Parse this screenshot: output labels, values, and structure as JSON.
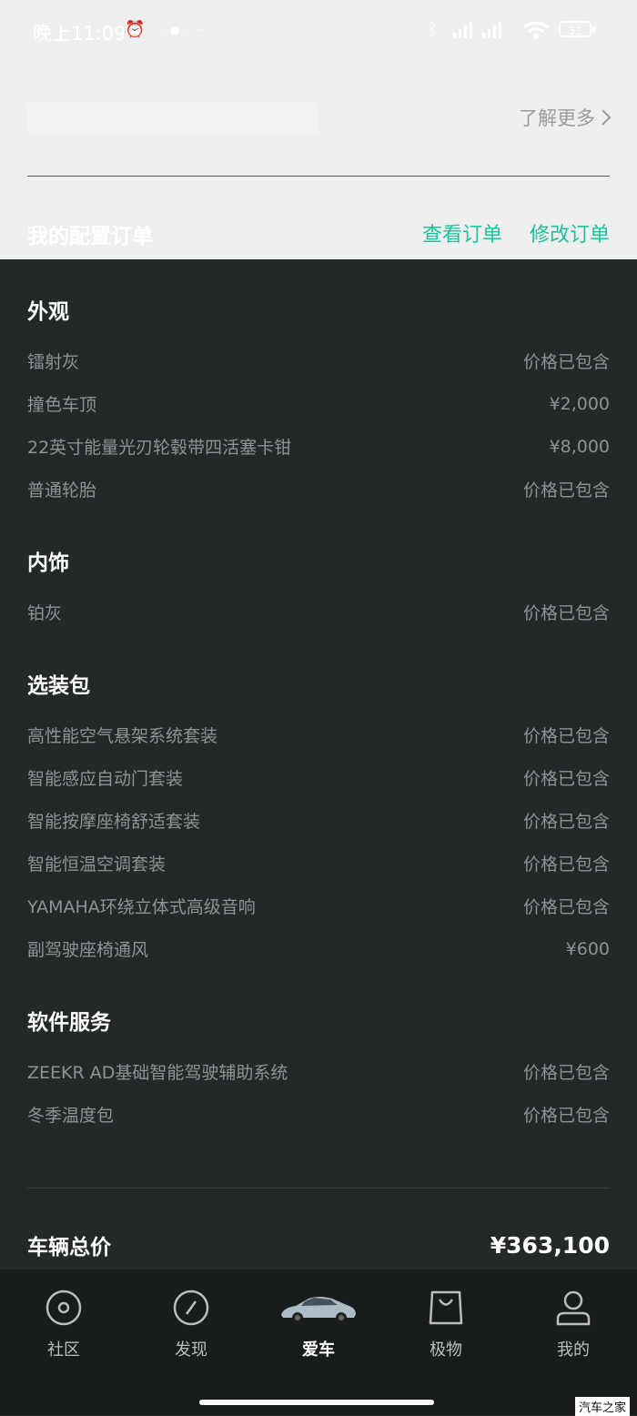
{
  "status_bar": {
    "time": "晚上11:09",
    "battery": "31"
  },
  "header": {
    "learn_more": "了解更多",
    "my_order": "我的配置订单",
    "view_order": "查看订单",
    "modify_order": "修改订单"
  },
  "groups": [
    {
      "title": "外观",
      "items": [
        {
          "name": "镭射灰",
          "price": "价格已包含"
        },
        {
          "name": "撞色车顶",
          "price": "¥2,000"
        },
        {
          "name": "22英寸能量光刃轮毂带四活塞卡钳",
          "price": "¥8,000"
        },
        {
          "name": "普通轮胎",
          "price": "价格已包含"
        }
      ]
    },
    {
      "title": "内饰",
      "items": [
        {
          "name": "铂灰",
          "price": "价格已包含"
        }
      ]
    },
    {
      "title": "选装包",
      "items": [
        {
          "name": "高性能空气悬架系统套装",
          "price": "价格已包含"
        },
        {
          "name": "智能感应自动门套装",
          "price": "价格已包含"
        },
        {
          "name": "智能按摩座椅舒适套装",
          "price": "价格已包含"
        },
        {
          "name": "智能恒温空调套装",
          "price": "价格已包含"
        },
        {
          "name": "YAMAHA环绕立体式高级音响",
          "price": "价格已包含"
        },
        {
          "name": "副驾驶座椅通风",
          "price": "¥600"
        }
      ]
    },
    {
      "title": "软件服务",
      "items": [
        {
          "name": "ZEEKR AD基础智能驾驶辅助系统",
          "price": "价格已包含"
        },
        {
          "name": "冬季温度包",
          "price": "价格已包含"
        }
      ]
    }
  ],
  "total": {
    "label": "车辆总价",
    "price": "¥363,100"
  },
  "tabs": [
    {
      "label": "社区",
      "icon": "community-icon"
    },
    {
      "label": "发现",
      "icon": "discover-icon"
    },
    {
      "label": "爱车",
      "icon": "car-icon"
    },
    {
      "label": "极物",
      "icon": "shop-bag-icon"
    },
    {
      "label": "我的",
      "icon": "profile-icon"
    }
  ],
  "watermark": "汽车之家",
  "colors": {
    "accent": "#1fc09c",
    "background": "#232829",
    "top_background": "#efefef"
  }
}
